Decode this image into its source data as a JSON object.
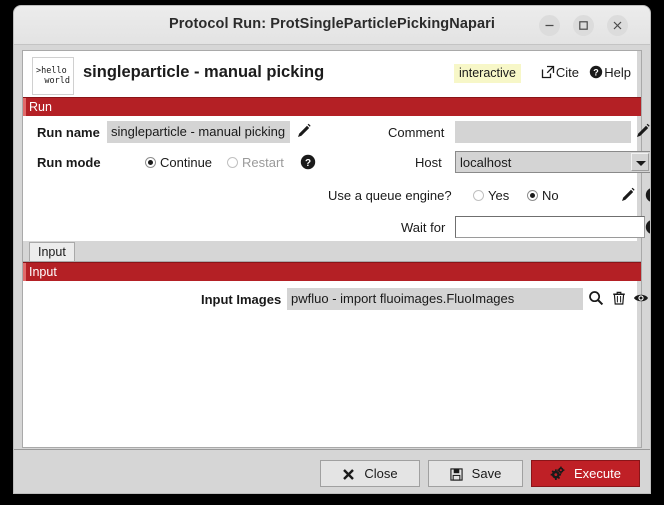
{
  "window": {
    "title": "Protocol Run: ProtSingleParticlePickingNapari",
    "minimize_label": "–",
    "maximize_label": "□",
    "close_label": "×"
  },
  "header": {
    "logo_line1": ">hello",
    "logo_line2": "world",
    "protocol_title": "singleparticle - manual picking",
    "interactive_badge": "interactive",
    "cite_label": "Cite",
    "help_label": "Help"
  },
  "run_section": {
    "bar_label": "Run",
    "run_name_label": "Run name",
    "run_name_value": "singleparticle - manual picking",
    "comment_label": "Comment",
    "comment_value": "",
    "run_mode_label": "Run mode",
    "run_mode_continue": "Continue",
    "run_mode_restart": "Restart",
    "run_mode_selected": "Continue",
    "host_label": "Host",
    "host_value": "localhost",
    "queue_label": "Use a queue engine?",
    "queue_yes": "Yes",
    "queue_no": "No",
    "queue_selected": "No",
    "wait_for_label": "Wait for",
    "wait_for_value": ""
  },
  "tabs": [
    {
      "label": "Input",
      "selected": true
    }
  ],
  "input_section": {
    "bar_label": "Input",
    "input_images_label": "Input Images",
    "input_images_value": "pwfluo - import fluoimages.FluoImages"
  },
  "footer": {
    "close_label": "Close",
    "save_label": "Save",
    "execute_label": "Execute"
  },
  "colors": {
    "section_red": "#b42025",
    "execute_red": "#bf2026",
    "badge_yellow": "#f7f7c8",
    "field_grey": "#d4d4d4",
    "window_grey": "#d6d6d6"
  }
}
